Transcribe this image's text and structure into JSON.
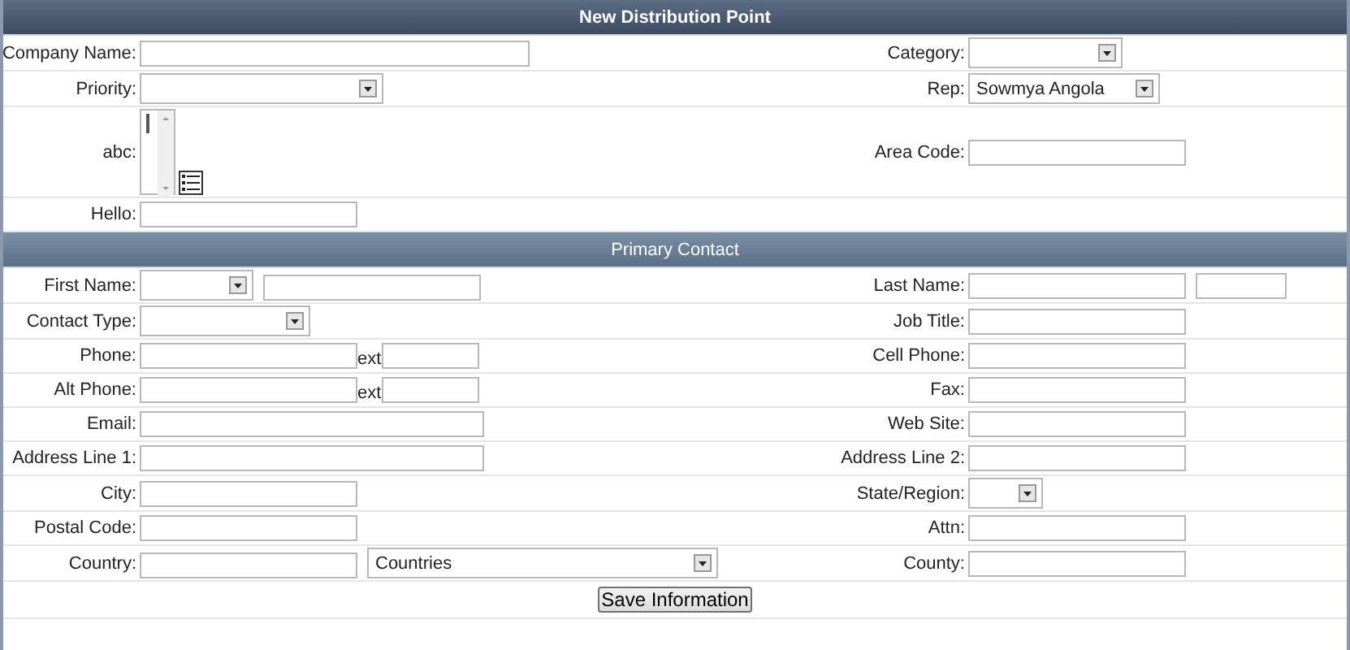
{
  "sections": [
    {
      "title": "New Distribution Point",
      "rows": [
        {
          "left": {
            "label": "Company Name:",
            "controls": [
              {
                "kind": "text"
              }
            ]
          },
          "right": {
            "label": "Category:",
            "controls": [
              {
                "kind": "select"
              }
            ]
          }
        },
        {
          "left": {
            "label": "Priority:",
            "controls": [
              {
                "kind": "select"
              }
            ]
          },
          "right": {
            "label": "Rep:",
            "controls": [
              {
                "kind": "select",
                "value": "Sowmya Angola"
              }
            ]
          }
        },
        {
          "left": {
            "label": "abc:",
            "controls": [
              {
                "kind": "listbox"
              }
            ]
          },
          "right": {
            "label": "Area Code:",
            "controls": [
              {
                "kind": "text"
              }
            ]
          }
        },
        {
          "left": {
            "label": "Hello:",
            "controls": [
              {
                "kind": "text"
              }
            ]
          }
        }
      ]
    },
    {
      "title": "Primary Contact",
      "rows": [
        {
          "left": {
            "label": "First Name:",
            "controls": [
              {
                "kind": "select"
              },
              {
                "kind": "text"
              }
            ]
          },
          "right": {
            "label": "Last Name:",
            "controls": [
              {
                "kind": "text"
              },
              {
                "kind": "text"
              }
            ]
          }
        },
        {
          "left": {
            "label": "Contact Type:",
            "controls": [
              {
                "kind": "select"
              }
            ]
          },
          "right": {
            "label": "Job Title:",
            "controls": [
              {
                "kind": "text"
              }
            ]
          }
        },
        {
          "left": {
            "label": "Phone:",
            "controls": [
              {
                "kind": "text"
              },
              {
                "kind": "caption",
                "text": "ext"
              },
              {
                "kind": "text"
              }
            ]
          },
          "right": {
            "label": "Cell Phone:",
            "controls": [
              {
                "kind": "text"
              }
            ]
          }
        },
        {
          "left": {
            "label": "Alt Phone:",
            "controls": [
              {
                "kind": "text"
              },
              {
                "kind": "caption",
                "text": "ext"
              },
              {
                "kind": "text"
              }
            ]
          },
          "right": {
            "label": "Fax:",
            "controls": [
              {
                "kind": "text"
              }
            ]
          }
        },
        {
          "left": {
            "label": "Email:",
            "controls": [
              {
                "kind": "text"
              }
            ]
          },
          "right": {
            "label": "Web Site:",
            "controls": [
              {
                "kind": "text"
              }
            ]
          }
        },
        {
          "left": {
            "label": "Address Line 1:",
            "controls": [
              {
                "kind": "text"
              }
            ]
          },
          "right": {
            "label": "Address Line 2:",
            "controls": [
              {
                "kind": "text"
              }
            ]
          }
        },
        {
          "left": {
            "label": "City:",
            "controls": [
              {
                "kind": "text"
              }
            ]
          },
          "right": {
            "label": "State/Region:",
            "controls": [
              {
                "kind": "select"
              }
            ]
          }
        },
        {
          "left": {
            "label": "Postal Code:",
            "controls": [
              {
                "kind": "text"
              }
            ]
          },
          "right": {
            "label": "Attn:",
            "controls": [
              {
                "kind": "text"
              }
            ]
          }
        },
        {
          "left": {
            "label": "Country:",
            "controls": [
              {
                "kind": "text"
              },
              {
                "kind": "select",
                "value": "Countries"
              }
            ]
          },
          "right": {
            "label": "County:",
            "controls": [
              {
                "kind": "text"
              }
            ]
          }
        }
      ]
    }
  ],
  "button": "Save Information"
}
